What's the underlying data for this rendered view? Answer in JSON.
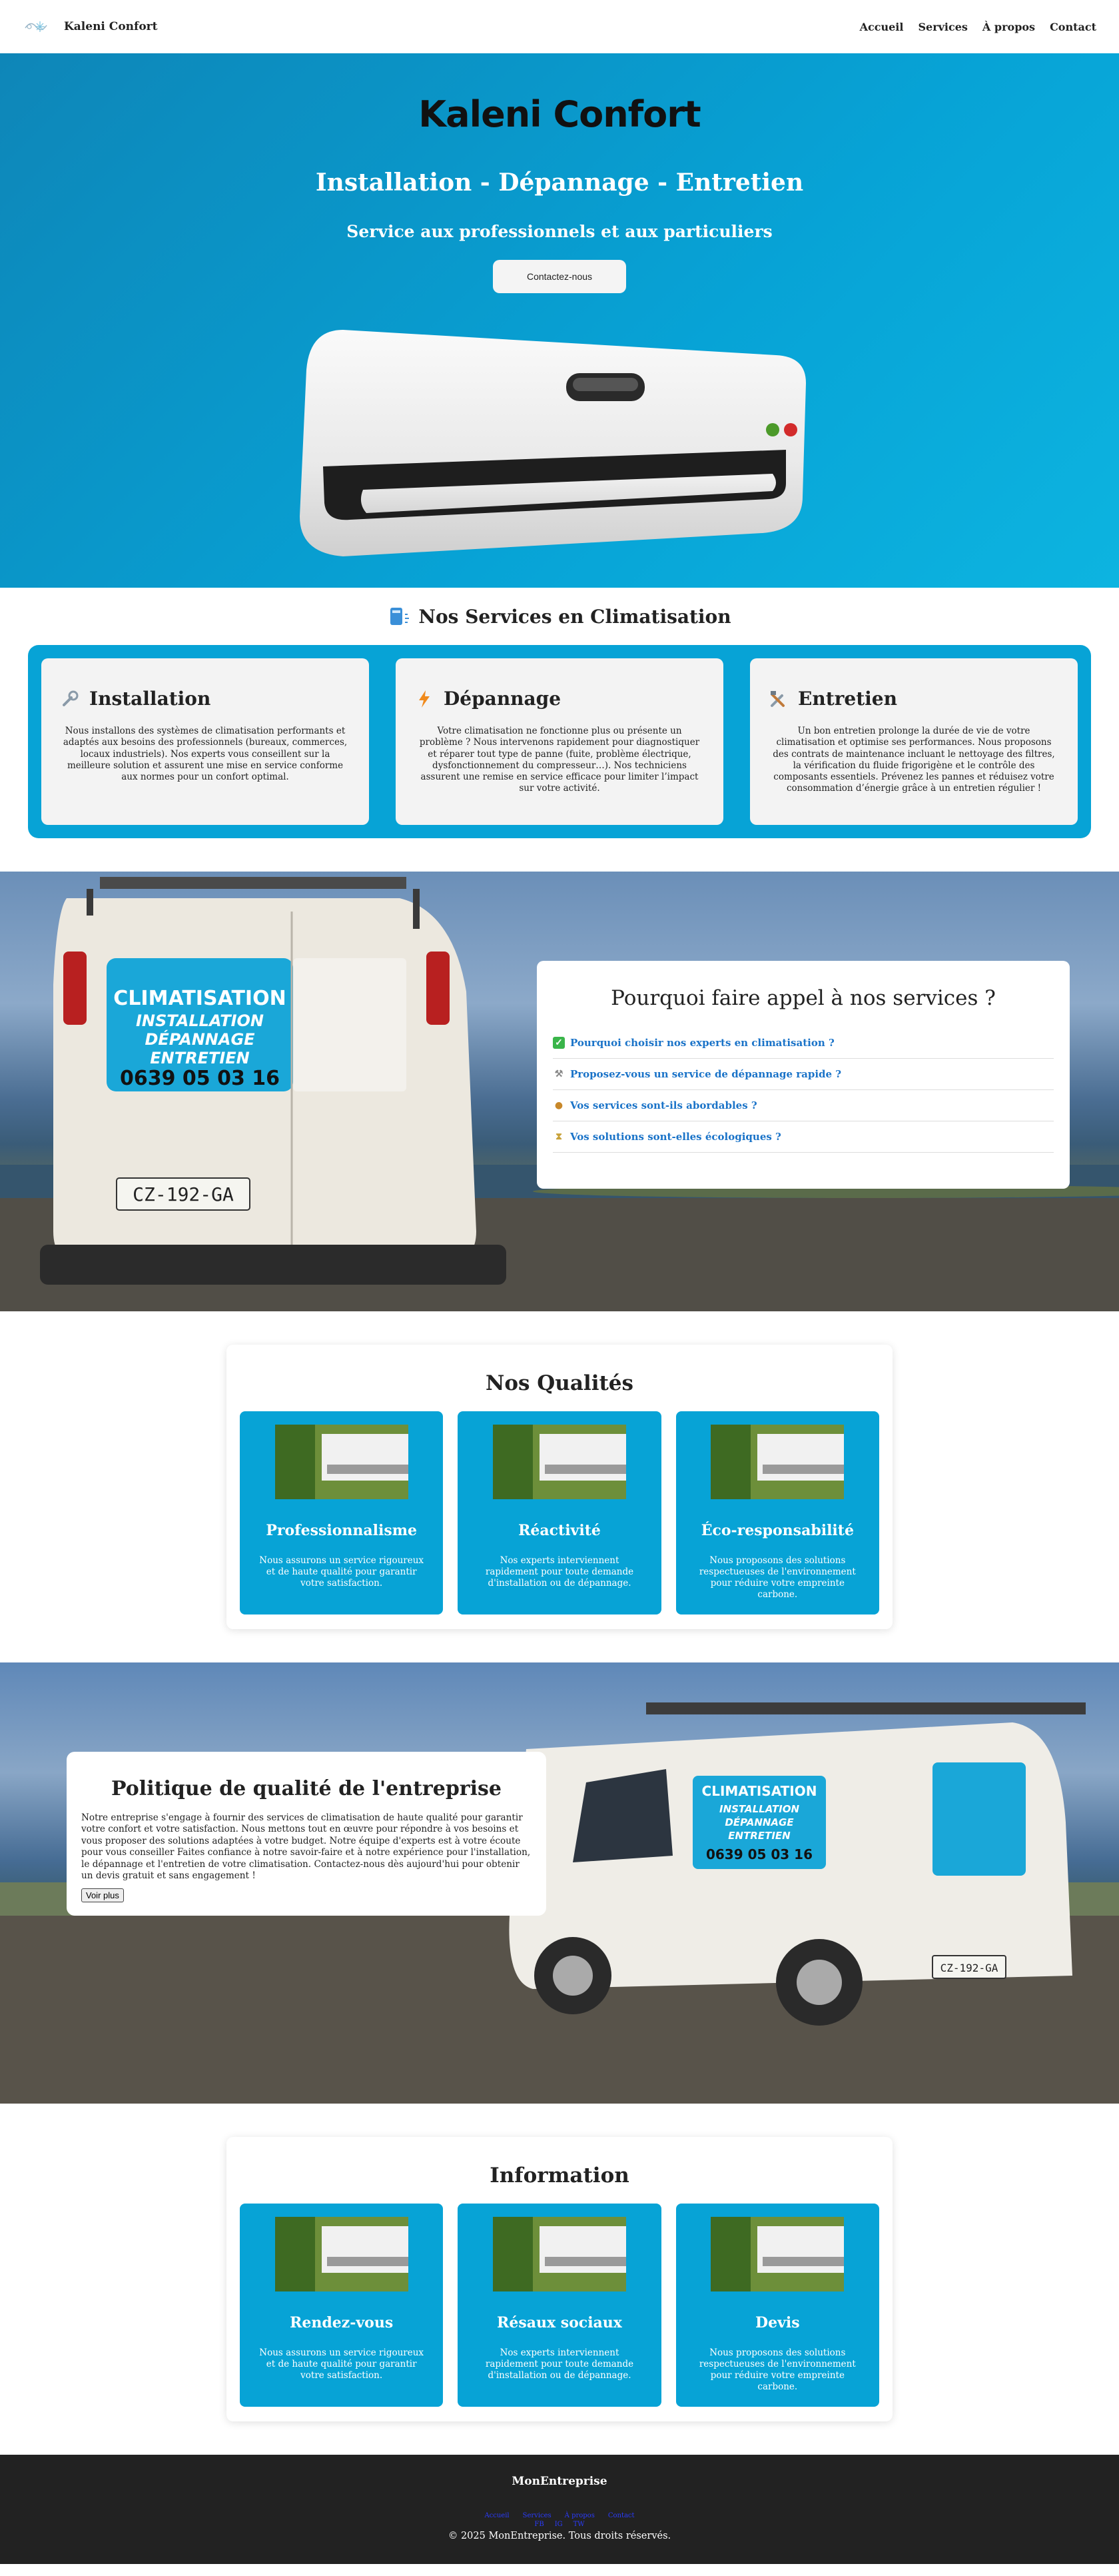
{
  "navbar": {
    "brand": "Kaleni Confort",
    "links": [
      "Accueil",
      "Services",
      "À propos",
      "Contact"
    ]
  },
  "hero": {
    "title": "Kaleni Confort",
    "subtitle": "Installation - Dépannage - Entretien",
    "tagline": "Service aux professionnels et aux particuliers",
    "cta": "Contactez-nous"
  },
  "services": {
    "title": "Nos Services en Climatisation",
    "items": [
      {
        "name": "Installation",
        "icon": "wrench-icon",
        "text": "Nous installons des systèmes de climatisation performants et adaptés aux besoins des professionnels (bureaux, commerces, locaux industriels). Nos experts vous conseillent sur la meilleure solution et assurent une mise en service conforme aux normes pour un confort optimal."
      },
      {
        "name": "Dépannage",
        "icon": "lightning-icon",
        "text": "Votre climatisation ne fonctionne plus ou présente un problème ? Nous intervenons rapidement pour diagnostiquer et réparer tout type de panne (fuite, problème électrique, dysfonctionnement du compresseur…). Nos techniciens assurent une remise en service efficace pour limiter l’impact sur votre activité."
      },
      {
        "name": "Entretien",
        "icon": "tools-icon",
        "text": "Un bon entretien prolonge la durée de vie de votre climatisation et optimise ses performances. Nous proposons des contrats de maintenance incluant le nettoyage des filtres, la vérification du fluide frigorigène et le contrôle des composants essentiels. Prévenez les pannes et réduisez votre consommation d’énergie grâce à un entretien régulier !"
      }
    ]
  },
  "why": {
    "title": "Pourquoi faire appel à nos services ?",
    "items": [
      {
        "icon": "check-icon",
        "text": "Pourquoi choisir nos experts en climatisation ?"
      },
      {
        "icon": "tools-icon",
        "text": "Proposez-vous un service de dépannage rapide ?"
      },
      {
        "icon": "money-icon",
        "text": "Vos services sont-ils abordables ?"
      },
      {
        "icon": "hourglass-icon",
        "text": "Vos solutions sont-elles écologiques ?"
      }
    ],
    "van_lines": [
      "CLIMATISATION",
      "INSTALLATION",
      "DÉPANNAGE",
      "ENTRETIEN",
      "0639 05 03 16"
    ],
    "plate": "CZ-192-GA"
  },
  "qualities": {
    "title": "Nos Qualités",
    "items": [
      {
        "name": "Professionnalisme",
        "text": "Nous assurons un service rigoureux et de haute qualité pour garantir votre satisfaction."
      },
      {
        "name": "Réactivité",
        "text": "Nos experts interviennent rapidement pour toute demande d'installation ou de dépannage."
      },
      {
        "name": "Éco-responsabilité",
        "text": "Nous proposons des solutions respectueuses de l'environnement pour réduire votre empreinte carbone."
      }
    ]
  },
  "policy": {
    "title": "Politique de qualité de l'entreprise",
    "text": "Notre entreprise s'engage à fournir des services de climatisation de haute qualité pour garantir votre confort et votre satisfaction. Nous mettons tout en œuvre pour répondre à vos besoins et vous proposer des solutions adaptées à votre budget. Notre équipe d'experts est à votre écoute pour vous conseiller Faites confiance à notre savoir-faire et à notre expérience pour l'installation, le dépannage et l'entretien de votre climatisation. Contactez-nous dès aujourd'hui pour obtenir un devis gratuit et sans engagement !",
    "button": "Voir plus"
  },
  "info": {
    "title": "Information",
    "items": [
      {
        "name": "Rendez-vous",
        "text": "Nous assurons un service rigoureux et de haute qualité pour garantir votre satisfaction."
      },
      {
        "name": "Résaux sociaux",
        "text": "Nos experts interviennent rapidement pour toute demande d'installation ou de dépannage."
      },
      {
        "name": "Devis",
        "text": "Nous proposons des solutions respectueuses de l'environnement pour réduire votre empreinte carbone."
      }
    ]
  },
  "footer": {
    "brand": "MonEntreprise",
    "links": [
      "Accueil",
      "Services",
      "À propos",
      "Contact"
    ],
    "social": [
      "FB",
      "IG",
      "TW"
    ],
    "copy": "© 2025 MonEntreprise. Tous droits réservés."
  },
  "colors": {
    "accent": "#07a3d6",
    "link": "#1a73c8",
    "footer_bg": "#222222"
  }
}
